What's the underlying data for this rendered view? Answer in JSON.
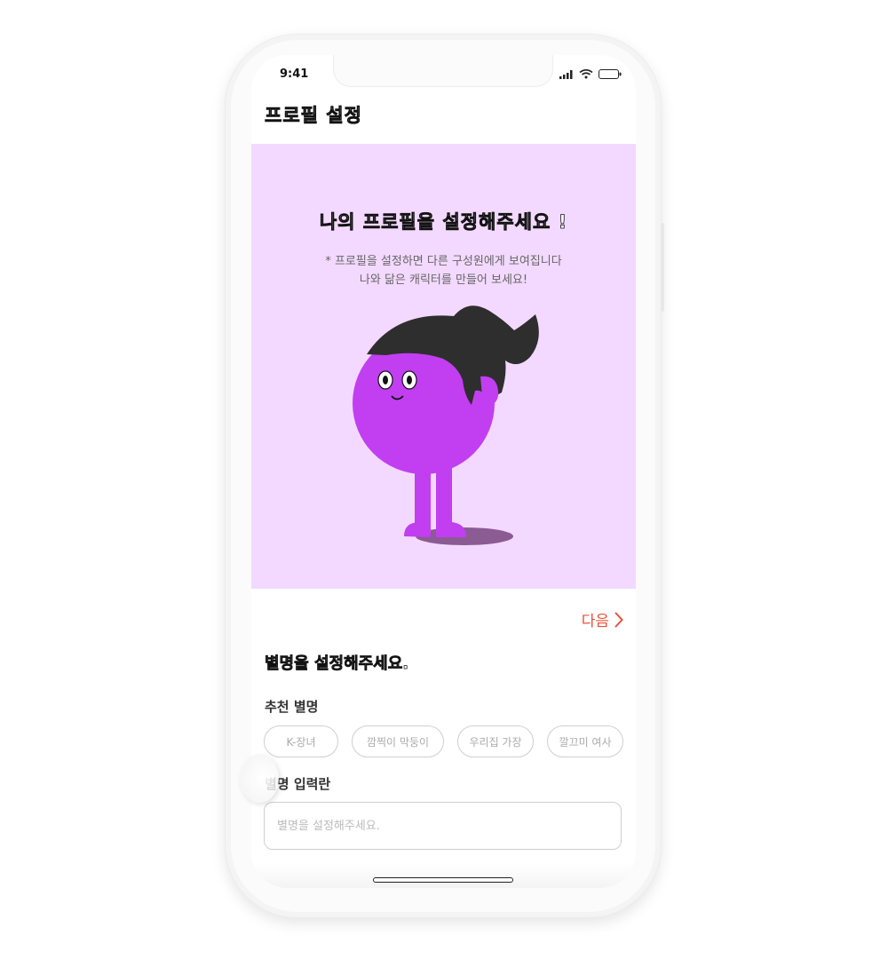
{
  "status_bar": {
    "time": "9:41"
  },
  "header": {
    "title": "프로필 설정"
  },
  "hero": {
    "title": "나의 프로필을 설정해주세요 !",
    "subtitle_line1": "* 프로필을 설정하면 다른 구성원에게 보여집니다",
    "subtitle_line2": "나와 닮은 캐릭터를 만들어 보세요!",
    "background_color": "#f3d9ff",
    "character_color": "#c13ff0",
    "hair_color": "#2e2e2e"
  },
  "next_button": {
    "label": "다음",
    "icon": "chevron-right-icon",
    "color": "#e9523a"
  },
  "nickname": {
    "title": "별명을 설정해주세요.",
    "recommend_label": "추천 별명",
    "recommendations": [
      "K-장녀",
      "깜찍이 막둥이",
      "우리집 가장",
      "깔끄미 여사"
    ],
    "input_label": "별명 입력란",
    "input_placeholder": "별명을 설정해주세요.",
    "input_value": ""
  }
}
